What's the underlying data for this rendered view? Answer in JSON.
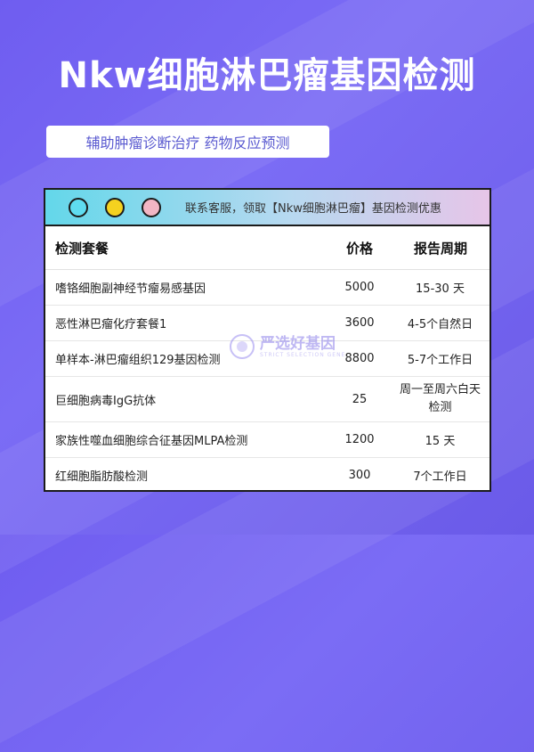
{
  "title": "Nkw细胞淋巴瘤基因检测",
  "subtitle": "辅助肿瘤诊断治疗 药物反应预测",
  "card": {
    "header_text": "联系客服，领取【Nkw细胞淋巴瘤】基因检测优惠",
    "columns": [
      "检测套餐",
      "价格",
      "报告周期"
    ],
    "rows": [
      {
        "name": "嗜铬细胞副神经节瘤易感基因",
        "price": "5000",
        "period": "15-30 天"
      },
      {
        "name": "恶性淋巴瘤化疗套餐1",
        "price": "3600",
        "period": "4-5个自然日"
      },
      {
        "name": "单样本-淋巴瘤组织129基因检测",
        "price": "8800",
        "period": "5-7个工作日"
      },
      {
        "name": "巨细胞病毒IgG抗体",
        "price": "25",
        "period": "周一至周六白天检测"
      },
      {
        "name": "家族性噬血细胞综合征基因MLPA检测",
        "price": "1200",
        "period": "15 天"
      },
      {
        "name": "红细胞脂肪酸检测",
        "price": "300",
        "period": "7个工作日"
      }
    ]
  },
  "watermark": {
    "text": "严选好基因",
    "sub": "STRICT SELECTION GENE"
  },
  "colors": {
    "background": "#6f5df0",
    "accent_text": "#5a5ad0",
    "header_gradient_start": "#63d7ea",
    "header_gradient_end": "#e6c5e8"
  },
  "icons": [
    "dot-blue-icon",
    "dot-yellow-icon",
    "dot-pink-icon"
  ]
}
